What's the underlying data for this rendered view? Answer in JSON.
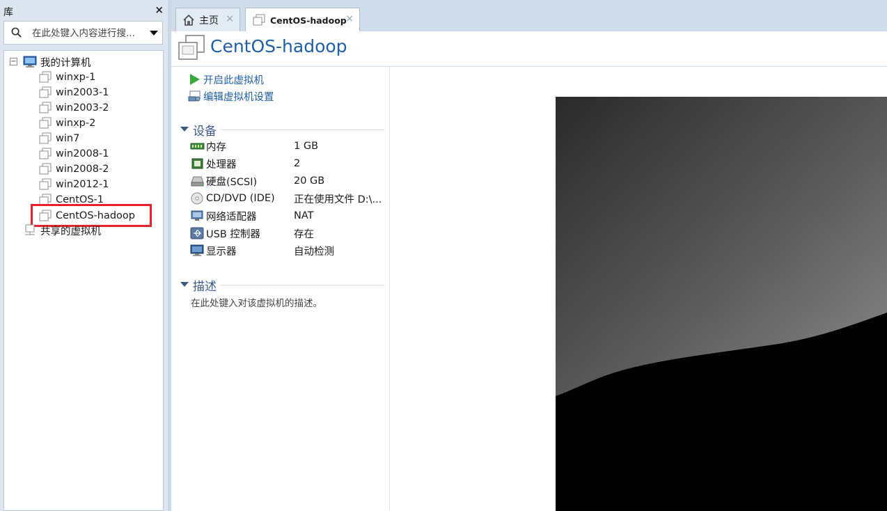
{
  "library": {
    "title": "库",
    "close_glyph": "×",
    "search_placeholder": "在此处键入内容进行搜...",
    "tree": {
      "root_label": "我的计算机",
      "root_toggle": "−",
      "vms": [
        {
          "label": "winxp-1"
        },
        {
          "label": "win2003-1"
        },
        {
          "label": "win2003-2"
        },
        {
          "label": "winxp-2"
        },
        {
          "label": "win7"
        },
        {
          "label": "win2008-1"
        },
        {
          "label": "win2008-2"
        },
        {
          "label": "win2012-1"
        },
        {
          "label": "CentOS-1"
        },
        {
          "label": "CentOS-hadoop",
          "selected": true
        }
      ],
      "shared_label": "共享的虚拟机"
    }
  },
  "tabs": [
    {
      "label": "主页",
      "icon": "home-icon",
      "close_glyph": "×"
    },
    {
      "label": "CentOS-hadoop",
      "icon": "vm-icon",
      "close_glyph": "×",
      "active": true
    }
  ],
  "vm": {
    "title": "CentOS-hadoop",
    "actions": [
      {
        "label": "开启此虚拟机",
        "icon": "play-icon"
      },
      {
        "label": "编辑虚拟机设置",
        "icon": "settings-icon"
      }
    ],
    "devices_section": "设备",
    "devices": [
      {
        "name": "内存",
        "value": "1 GB",
        "icon": "memory-icon"
      },
      {
        "name": "处理器",
        "value": "2",
        "icon": "processor-icon"
      },
      {
        "name": "硬盘(SCSI)",
        "value": "20 GB",
        "icon": "hard-disk-icon"
      },
      {
        "name": "CD/DVD (IDE)",
        "value": "正在使用文件 D:\\...",
        "icon": "cd-dvd-icon"
      },
      {
        "name": "网络适配器",
        "value": "NAT",
        "icon": "network-adapter-icon"
      },
      {
        "name": "USB 控制器",
        "value": "存在",
        "icon": "usb-icon"
      },
      {
        "name": "显示器",
        "value": "自动检测",
        "icon": "display-icon"
      }
    ],
    "description_section": "描述",
    "description_placeholder": "在此处键入对该虚拟机的描述。"
  },
  "colors": {
    "accent": "#1f5fa8",
    "section": "#3d5c8c",
    "selection_outline": "#e8202a"
  }
}
